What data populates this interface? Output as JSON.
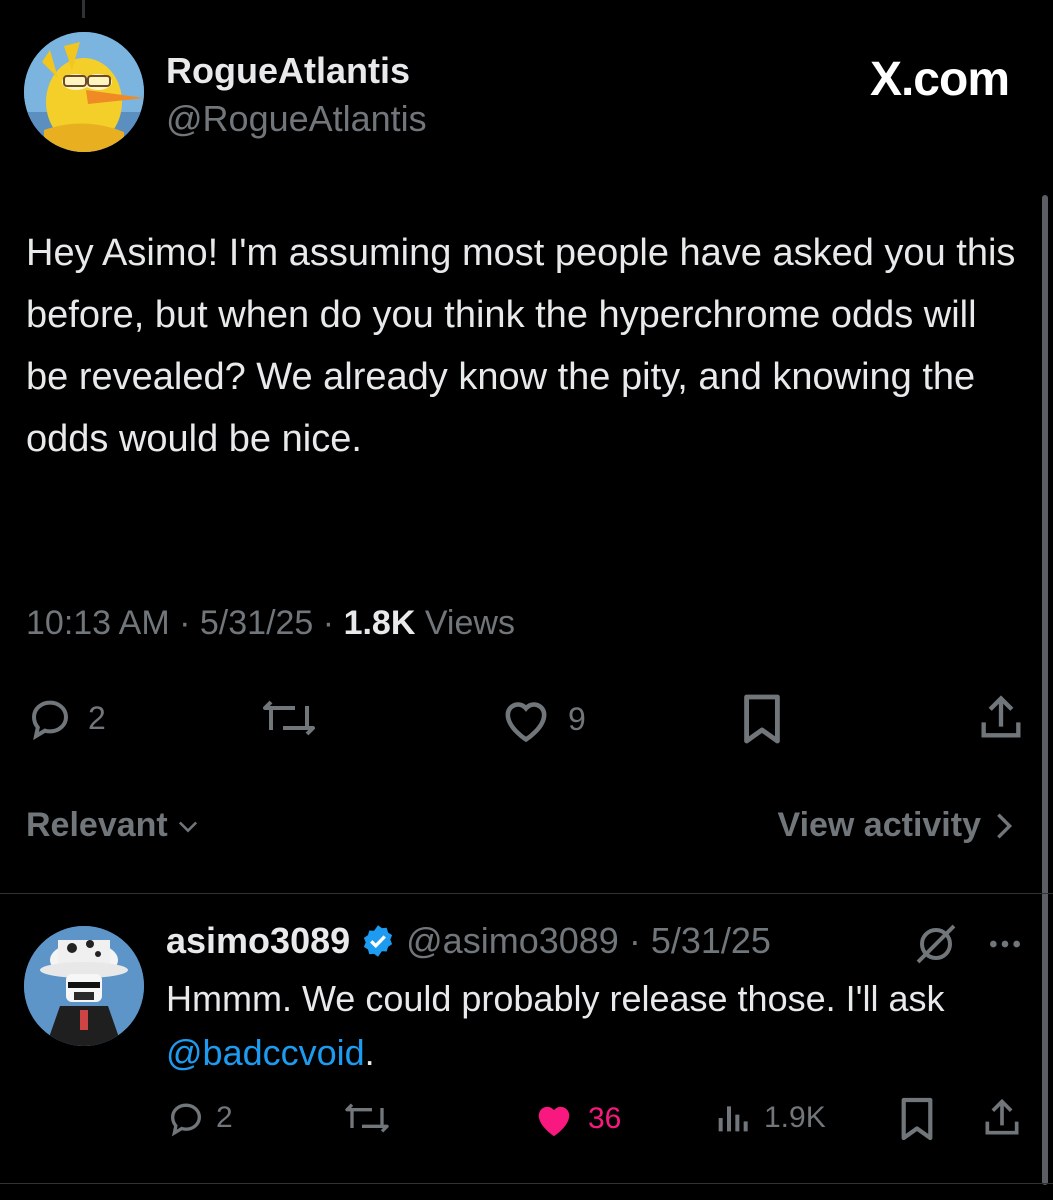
{
  "tweet": {
    "display_name": "RogueAtlantis",
    "handle": "@RogueAtlantis",
    "brand": "X.com",
    "text": "Hey Asimo! I'm assuming most people have asked you this before, but when do you think the hyperchrome odds will be revealed? We already know the pity, and knowing the odds would be nice.",
    "time": "10:13 AM",
    "date": "5/31/25",
    "views_count": "1.8K",
    "views_label": "Views",
    "dot": "·",
    "actions": {
      "replies": "2",
      "likes": "9"
    }
  },
  "sort": {
    "label": "Relevant",
    "activity_label": "View activity"
  },
  "reply": {
    "display_name": "asimo3089",
    "handle": "@asimo3089",
    "date": "5/31/25",
    "dot": "·",
    "text_before": "Hmmm. We could probably release those. I'll ask ",
    "mention": "@badccvoid",
    "text_after": ".",
    "actions": {
      "replies": "2",
      "likes": "36",
      "views": "1.9K"
    }
  },
  "icons": {
    "reply": "reply-icon",
    "retweet": "retweet-icon",
    "like": "heart-icon",
    "bookmark": "bookmark-icon",
    "share": "share-icon",
    "views": "analytics-icon",
    "verified": "verified-badge-icon",
    "grok": "grok-icon",
    "more": "more-icon",
    "chevron_down": "chevron-down-icon",
    "chevron_right": "chevron-right-icon"
  },
  "colors": {
    "background": "#000000",
    "text": "#e7e9ea",
    "muted": "#71767b",
    "link": "#1d9bf0",
    "like": "#f91880",
    "verified": "#1d9bf0"
  }
}
